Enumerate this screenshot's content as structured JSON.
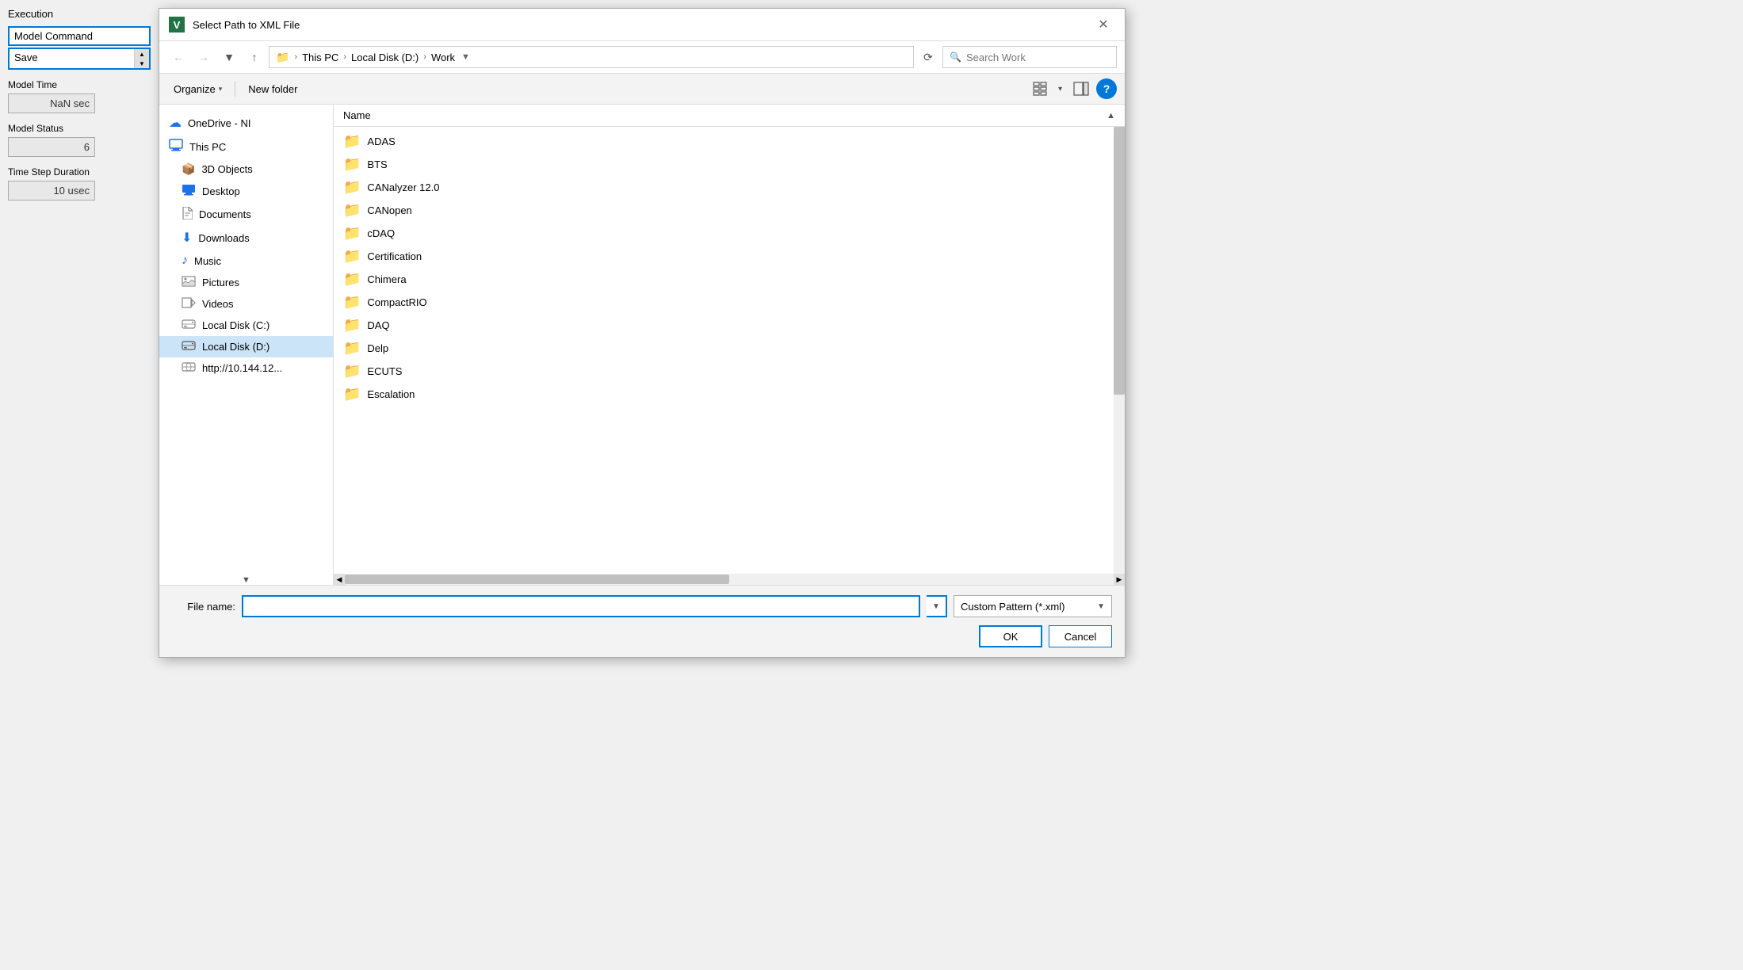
{
  "app": {
    "section_title": "Execution",
    "model_command_label": "Model Command",
    "model_command_value": "Save",
    "model_time_label": "Model Time",
    "model_time_value": "NaN sec",
    "model_status_label": "Model Status",
    "model_status_value": "6",
    "time_step_label": "Time Step Duration",
    "time_step_value": "10 usec"
  },
  "dialog": {
    "title": "Select Path to XML File",
    "title_icon": "V",
    "close_label": "✕"
  },
  "toolbar": {
    "back_title": "Back",
    "forward_title": "Forward",
    "dropdown_title": "Recent locations",
    "up_title": "Up",
    "refresh_title": "Refresh",
    "breadcrumb": {
      "parts": [
        "This PC",
        "Local Disk (D:)",
        "Work"
      ],
      "separator": "›"
    },
    "search_placeholder": "Search Work"
  },
  "commandbar": {
    "organize_label": "Organize",
    "organize_arrow": "▾",
    "new_folder_label": "New folder",
    "view_label": "View"
  },
  "sidebar": {
    "items": [
      {
        "id": "onedrive",
        "label": "OneDrive - NI",
        "icon": "☁",
        "icon_class": "icon-cloud"
      },
      {
        "id": "this-pc",
        "label": "This PC",
        "icon": "🖥",
        "icon_class": "icon-computer"
      },
      {
        "id": "3d-objects",
        "label": "3D Objects",
        "icon": "📦",
        "icon_class": "icon-3d",
        "indent": true
      },
      {
        "id": "desktop",
        "label": "Desktop",
        "icon": "🖥",
        "icon_class": "icon-desktop",
        "indent": true
      },
      {
        "id": "documents",
        "label": "Documents",
        "icon": "📄",
        "icon_class": "icon-docs",
        "indent": true
      },
      {
        "id": "downloads",
        "label": "Downloads",
        "icon": "⬇",
        "icon_class": "icon-downloads",
        "indent": true
      },
      {
        "id": "music",
        "label": "Music",
        "icon": "♪",
        "icon_class": "icon-music",
        "indent": true
      },
      {
        "id": "pictures",
        "label": "Pictures",
        "icon": "🖼",
        "icon_class": "icon-pictures",
        "indent": true
      },
      {
        "id": "videos",
        "label": "Videos",
        "icon": "🎞",
        "icon_class": "icon-videos",
        "indent": true
      },
      {
        "id": "local-c",
        "label": "Local Disk (C:)",
        "icon": "💿",
        "icon_class": "icon-disk",
        "indent": true
      },
      {
        "id": "local-d",
        "label": "Local Disk (D:)",
        "icon": "💿",
        "icon_class": "icon-disk-d",
        "indent": true,
        "active": true
      },
      {
        "id": "network",
        "label": "http://10.144.12...",
        "icon": "🌐",
        "icon_class": "icon-network",
        "indent": true
      }
    ]
  },
  "filelist": {
    "column_name": "Name",
    "folders": [
      "ADAS",
      "BTS",
      "CANalyzer 12.0",
      "CANopen",
      "cDAQ",
      "Certification",
      "Chimera",
      "CompactRIO",
      "DAQ",
      "Delp",
      "ECUTS",
      "Escalation"
    ]
  },
  "bottom": {
    "filename_label": "File name:",
    "filename_value": "",
    "filename_placeholder": "",
    "filetype_label": "Custom Pattern (*.xml)",
    "ok_label": "OK",
    "cancel_label": "Cancel"
  }
}
